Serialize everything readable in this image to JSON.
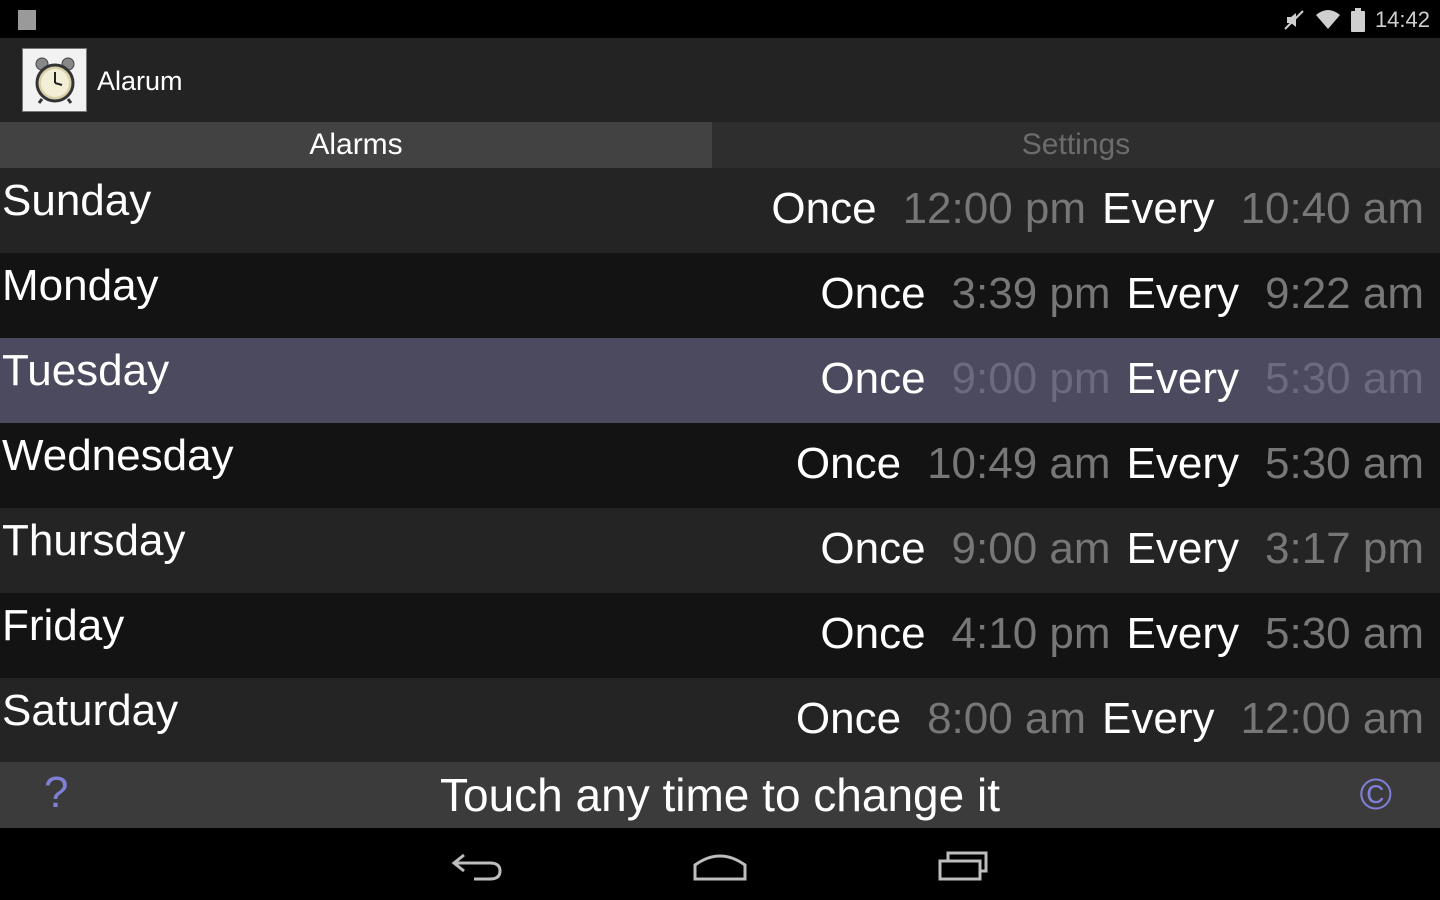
{
  "status_bar": {
    "time": "14:42",
    "icons": [
      "notification-icon",
      "mute-icon",
      "wifi-icon",
      "battery-icon"
    ]
  },
  "action_bar": {
    "app_title": "Alarum",
    "app_icon": "alarm-clock-icon"
  },
  "tabs": [
    {
      "label": "Alarms",
      "selected": true
    },
    {
      "label": "Settings",
      "selected": false
    }
  ],
  "alarms": [
    {
      "day": "Sunday",
      "once_label": "Once",
      "once_time": "12:00 pm",
      "every_label": "Every",
      "every_time": "10:40 am"
    },
    {
      "day": "Monday",
      "once_label": "Once",
      "once_time": "3:39 pm",
      "every_label": "Every",
      "every_time": "9:22 am"
    },
    {
      "day": "Tuesday",
      "once_label": "Once",
      "once_time": "9:00 pm",
      "every_label": "Every",
      "every_time": "5:30 am"
    },
    {
      "day": "Wednesday",
      "once_label": "Once",
      "once_time": "10:49 am",
      "every_label": "Every",
      "every_time": "5:30 am"
    },
    {
      "day": "Thursday",
      "once_label": "Once",
      "once_time": "9:00 am",
      "every_label": "Every",
      "every_time": "3:17 pm"
    },
    {
      "day": "Friday",
      "once_label": "Once",
      "once_time": "4:10 pm",
      "every_label": "Every",
      "every_time": "5:30 am"
    },
    {
      "day": "Saturday",
      "once_label": "Once",
      "once_time": "8:00 am",
      "every_label": "Every",
      "every_time": "12:00 am"
    }
  ],
  "selected_day": "Tuesday",
  "footer": {
    "help_label": "?",
    "hint": "Touch any time to change it",
    "copyright_label": "©"
  },
  "nav_bar": {
    "icons": [
      "back-icon",
      "home-icon",
      "recent-apps-icon"
    ]
  },
  "colors": {
    "accent": "#7f7fd6",
    "selected_row": "#4b4a5e",
    "time_value": "#777777"
  }
}
